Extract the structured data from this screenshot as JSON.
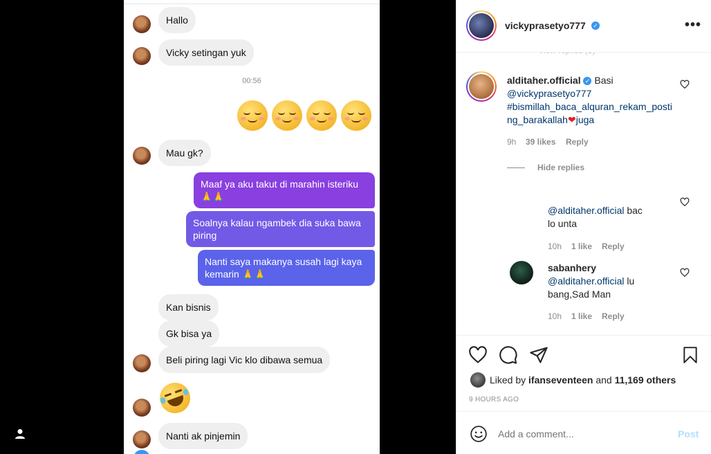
{
  "chat": {
    "messages_in_top": [
      "Hallo",
      "Vicky setingan yuk"
    ],
    "timestamp": "00:56",
    "mau": "Mau gk?",
    "out": [
      "Maaf ya aku takut di marahin isteriku 🙏🙏",
      "Soalnya kalau ngambek dia suka bawa piring",
      "Nanti saya makanya susah lagi kaya kemarin 🙏🙏"
    ],
    "messages_in_bottom": [
      "Kan bisnis",
      "Gk bisa ya",
      "Beli piring lagi Vic klo dibawa semua"
    ],
    "last": "Nanti ak pinjemin"
  },
  "post": {
    "author": "vickyprasetyo777",
    "faded_replies": "View replies (3)",
    "comment": {
      "user": "alditaher.official",
      "text_plain": "Basi",
      "mention": "@vickyprasetyo777",
      "hashtag": "#bismillah_baca_alquran_rekam_posting_barakallah",
      "suffix": "juga",
      "time": "9h",
      "likes": "39 likes",
      "reply": "Reply",
      "hide": "Hide replies"
    },
    "reply1": {
      "mention": "@alditaher.official",
      "text": "bac",
      "line2": "lo unta",
      "time": "10h",
      "likes": "1 like",
      "reply": "Reply"
    },
    "reply2": {
      "user": "sabanhery",
      "mention": "@alditaher.official",
      "text": "lu",
      "line2": "bang,Sad Man",
      "time": "10h",
      "likes": "1 like",
      "reply": "Reply"
    },
    "liked_by_prefix": "Liked by",
    "liked_by_user": "ifanseventeen",
    "liked_by_and": "and",
    "liked_by_others": "11,169 others",
    "time_ago": "9 HOURS AGO",
    "add_comment_placeholder": "Add a comment...",
    "post_button": "Post"
  },
  "colors": {
    "bubble_purple": "#8a3fe0",
    "bubble_blue": "#5a63ea",
    "ig_link": "#00376b",
    "post_disabled": "#b2dffc",
    "verified_blue": "#3897f0"
  }
}
